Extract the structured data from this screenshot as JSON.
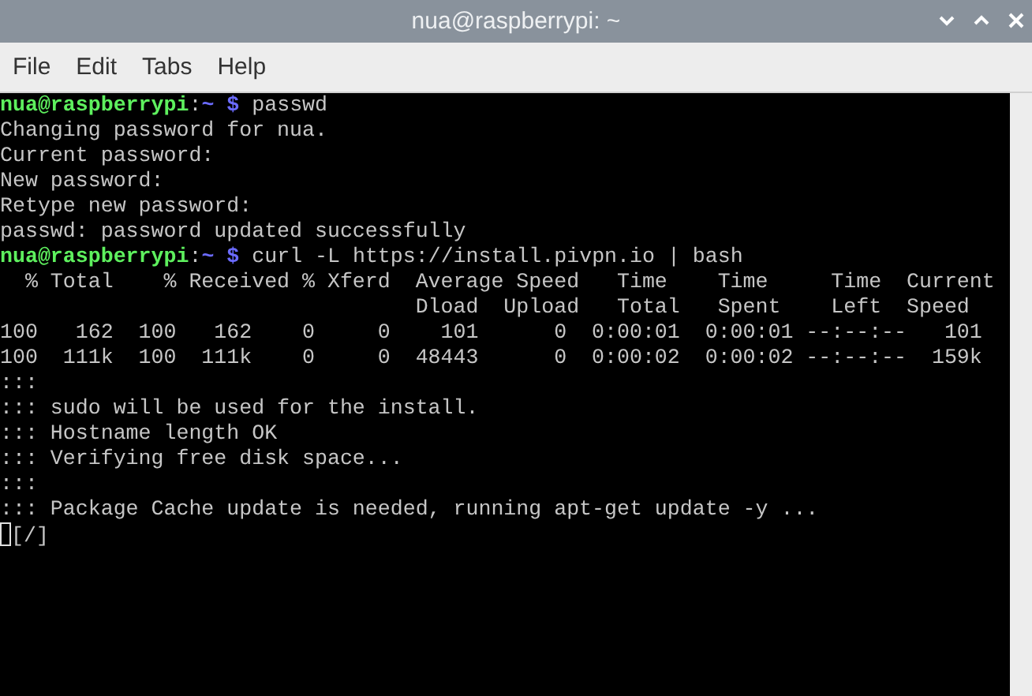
{
  "window": {
    "title": "nua@raspberrypi: ~"
  },
  "menu": [
    "File",
    "Edit",
    "Tabs",
    "Help"
  ],
  "terminal": {
    "lines": [
      {
        "kind": "prompt",
        "user": "nua@raspberrypi",
        "separator": ":",
        "path": "~",
        "symbol": "$",
        "command": "passwd"
      },
      {
        "kind": "output",
        "text": "Changing password for nua."
      },
      {
        "kind": "output",
        "text": "Current password:"
      },
      {
        "kind": "output",
        "text": "New password:"
      },
      {
        "kind": "output",
        "text": "Retype new password:"
      },
      {
        "kind": "output",
        "text": "passwd: password updated successfully"
      },
      {
        "kind": "prompt",
        "user": "nua@raspberrypi",
        "separator": ":",
        "path": "~",
        "symbol": "$",
        "command": "curl -L https://install.pivpn.io | bash"
      },
      {
        "kind": "output",
        "text": "  % Total    % Received % Xferd  Average Speed   Time    Time     Time  Current"
      },
      {
        "kind": "output",
        "text": "                                 Dload  Upload   Total   Spent    Left  Speed"
      },
      {
        "kind": "output",
        "text": "100   162  100   162    0     0    101      0  0:00:01  0:00:01 --:--:--   101"
      },
      {
        "kind": "output",
        "text": "100  111k  100  111k    0     0  48443      0  0:00:02  0:00:02 --:--:--  159k"
      },
      {
        "kind": "output",
        "text": ":::"
      },
      {
        "kind": "output",
        "text": "::: sudo will be used for the install."
      },
      {
        "kind": "output",
        "text": "::: Hostname length OK"
      },
      {
        "kind": "output",
        "text": "::: Verifying free disk space..."
      },
      {
        "kind": "output",
        "text": ":::"
      },
      {
        "kind": "output",
        "text": "::: Package Cache update is needed, running apt-get update -y ..."
      },
      {
        "kind": "output",
        "text": "[/]",
        "cursor": true
      }
    ]
  }
}
